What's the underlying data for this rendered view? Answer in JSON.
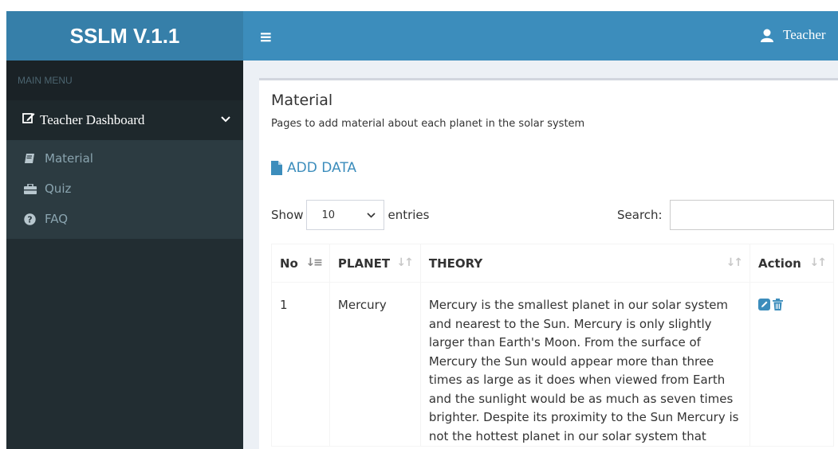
{
  "brand": {
    "title": "SSLM V.1.1"
  },
  "header": {
    "toggle_icon": "hamburger-icon",
    "user_label": "Teacher"
  },
  "sidebar": {
    "section_label": "MAIN MENU",
    "parent": {
      "label": "Teacher Dashboard",
      "icon": "edit-icon"
    },
    "items": [
      {
        "label": "Material",
        "icon": "book-icon"
      },
      {
        "label": "Quiz",
        "icon": "briefcase-icon"
      },
      {
        "label": "FAQ",
        "icon": "question-circle-icon"
      }
    ]
  },
  "page": {
    "title": "Material",
    "subtitle": "Pages to add material about each planet in the solar system",
    "add_data_label": "ADD DATA"
  },
  "table_controls": {
    "show_label": "Show",
    "entries_value": "10",
    "entries_label": "entries",
    "search_label": "Search:",
    "search_value": ""
  },
  "table": {
    "headers": [
      "No",
      "PLANET",
      "THEORY",
      "Action"
    ],
    "rows": [
      {
        "no": "1",
        "planet": "Mercury",
        "theory": "Mercury is the smallest planet in our solar system and nearest to the Sun. Mercury is only slightly larger than Earth's Moon. From the surface of Mercury the Sun would appear more than three times as large as it does when viewed from Earth and the sunlight would be as much as seven times brighter. Despite its proximity to the Sun Mercury is not the hottest planet in our solar system that"
      }
    ]
  },
  "colors": {
    "header": "#3c8dbc",
    "brand": "#367fa9",
    "sidebar": "#222d32",
    "accent": "#3c8dbc"
  }
}
